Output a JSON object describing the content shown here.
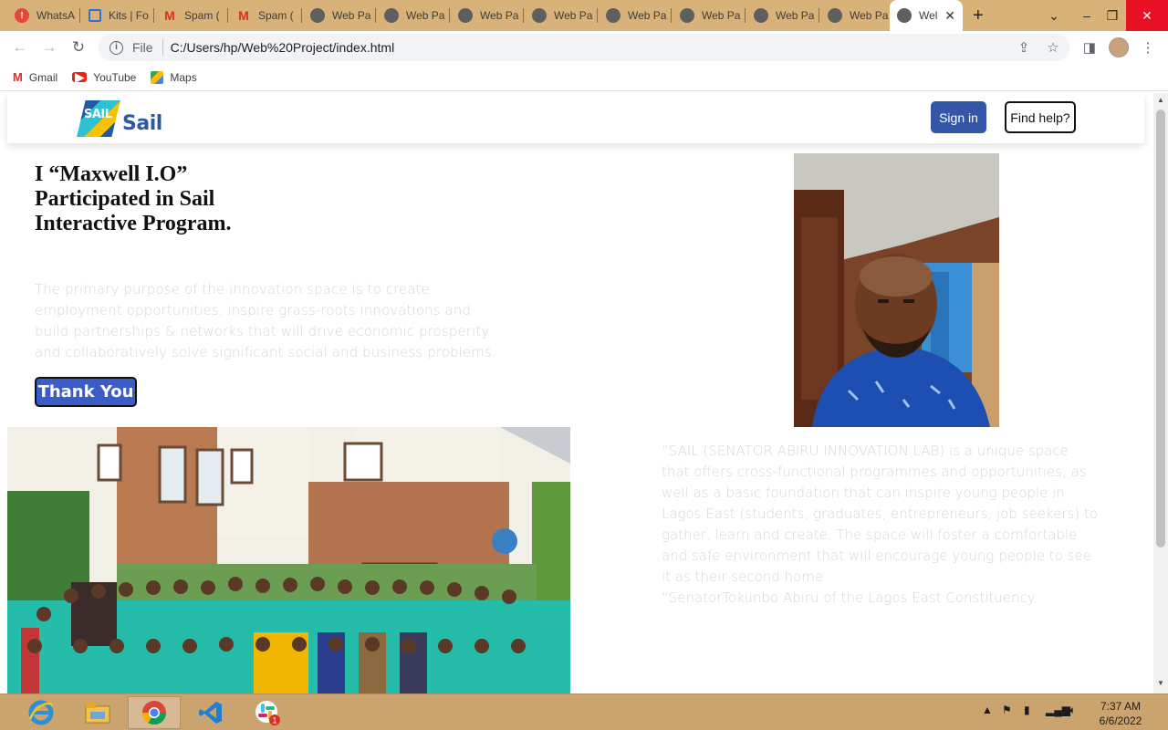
{
  "browser": {
    "tabs": [
      {
        "label": "WhatsA",
        "icon": "whatsapp-alert-icon"
      },
      {
        "label": "Kits | Fo",
        "icon": "kits-flag-icon"
      },
      {
        "label": "Spam (",
        "icon": "gmail-icon"
      },
      {
        "label": "Spam (",
        "icon": "gmail-icon"
      },
      {
        "label": "Web Pa",
        "icon": "globe-icon"
      },
      {
        "label": "Web Pa",
        "icon": "globe-icon"
      },
      {
        "label": "Web Pa",
        "icon": "globe-icon"
      },
      {
        "label": "Web Pa",
        "icon": "globe-icon"
      },
      {
        "label": "Web Pa",
        "icon": "globe-icon"
      },
      {
        "label": "Web Pa",
        "icon": "globe-icon"
      },
      {
        "label": "Web Pa",
        "icon": "globe-icon"
      },
      {
        "label": "Web Pa",
        "icon": "globe-icon"
      },
      {
        "label": "Wel",
        "icon": "globe-icon",
        "active": true
      }
    ],
    "new_tab_symbol": "+",
    "address": {
      "scheme_label": "File",
      "url": "C:/Users/hp/Web%20Project/index.html"
    },
    "bookmarks": [
      {
        "label": "Gmail",
        "icon": "gmail-icon"
      },
      {
        "label": "YouTube",
        "icon": "youtube-icon"
      },
      {
        "label": "Maps",
        "icon": "maps-icon"
      }
    ]
  },
  "site": {
    "logo_mark_text": "SAIL",
    "logo_text": "Sail",
    "nav": {
      "signin_label": "Sign in",
      "help_label": "Find help?"
    },
    "hero": {
      "title": "I “Maxwell I.O” Participated in Sail Interactive Program.",
      "description": "The primary purpose of the innovation space is to create employment opportunities, inspire grass-roots innovations and build partnerships & networks that will drive economic prosperity and collaboratively solve significant social and business problems.",
      "button_label": "Thank You"
    },
    "quote": {
      "text": "“SAIL (SENATOR ABIRU INNOVATION LAB) is a unique space that offers cross-functional programmes and opportunities, as well as a basic foundation that can inspire young people in Lagos East (students, graduates, entrepreneurs, job seekers) to gather, learn and create. The space will foster a comfortable and safe environment that will encourage young people to see it as their second home",
      "attribution": "“SenatorTokunbo Abiru of the Lagos East Constituency."
    }
  },
  "taskbar": {
    "apps": [
      "internet-explorer-icon",
      "file-explorer-icon",
      "chrome-icon",
      "vscode-icon",
      "slack-icon"
    ],
    "slack_badge": "1",
    "time": "7:37 AM",
    "date": "6/6/2022"
  },
  "colors": {
    "tab_strip": "#d9b27a",
    "taskbar": "#caa36f",
    "brand_blue": "#3356a8",
    "thank_button": "#3b5bc6",
    "muted_text": "#d7d7d7"
  }
}
